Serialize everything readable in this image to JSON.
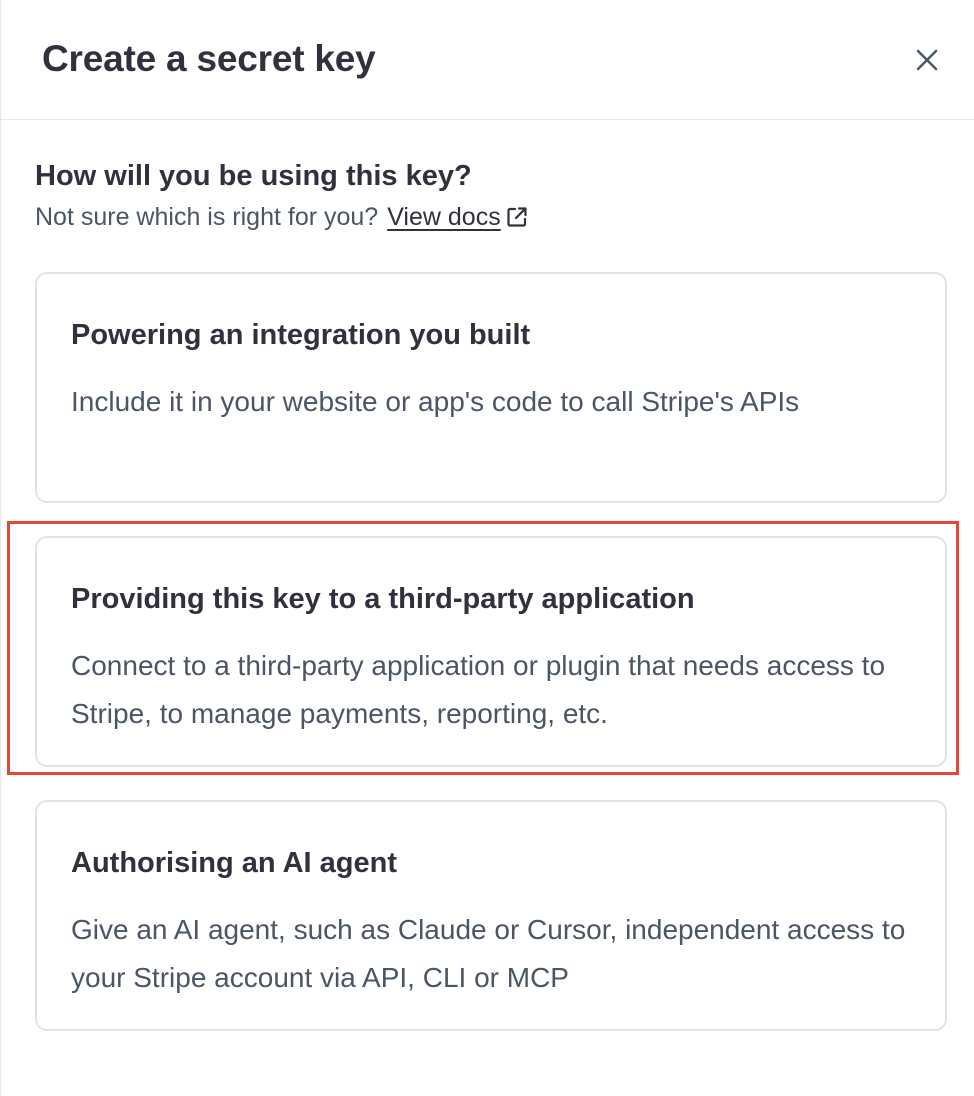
{
  "dialog": {
    "title": "Create a secret key",
    "close_icon": "close-icon"
  },
  "prompt": {
    "question": "How will you be using this key?",
    "helper_text": "Not sure which is right for you?",
    "docs_link": "View docs",
    "docs_link_icon": "external-link-icon"
  },
  "options": [
    {
      "title": "Powering an integration you built",
      "description": "Include it in your website or app's code to call Stripe's APIs"
    },
    {
      "title": "Providing this key to a third-party application",
      "description": "Connect to a third-party application or plugin that needs access to Stripe, to manage payments, reporting, etc."
    },
    {
      "title": "Authorising an AI agent",
      "description": "Give an AI agent, such as Claude or Cursor, independent access to your Stripe account via API, CLI or MCP"
    }
  ],
  "colors": {
    "highlight": "#e14b34",
    "card_border": "#dfe3e8",
    "title_text": "#30313d",
    "body_text": "#4a5566"
  }
}
